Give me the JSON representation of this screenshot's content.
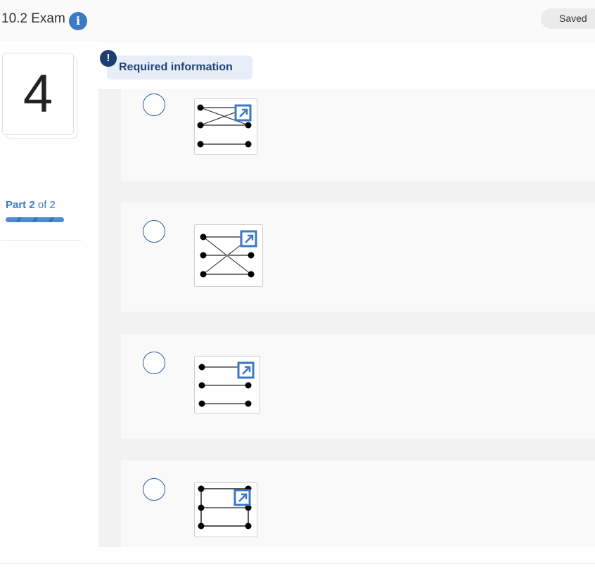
{
  "header": {
    "title": "10.2 Exam",
    "info_icon": "info-icon",
    "saved_label": "Saved"
  },
  "sidebar": {
    "question_number": "4",
    "part_prefix": "Part",
    "part_current": "2",
    "part_of": "of 2",
    "progress_fraction": 1.0
  },
  "main": {
    "required_label": "Required information",
    "alert_glyph": "!",
    "options": [
      {
        "id": "a",
        "icon": "graph-thumbnail-icon",
        "expand_icon": "expand-icon",
        "selected": false
      },
      {
        "id": "b",
        "icon": "graph-thumbnail-icon",
        "expand_icon": "expand-icon",
        "selected": false
      },
      {
        "id": "c",
        "icon": "graph-thumbnail-icon",
        "expand_icon": "expand-icon",
        "selected": false
      },
      {
        "id": "d",
        "icon": "graph-thumbnail-icon",
        "expand_icon": "expand-icon",
        "selected": false
      }
    ]
  },
  "colors": {
    "accent": "#3b79c2",
    "alert": "#1d3e70",
    "radio_border": "#2d5f93"
  }
}
